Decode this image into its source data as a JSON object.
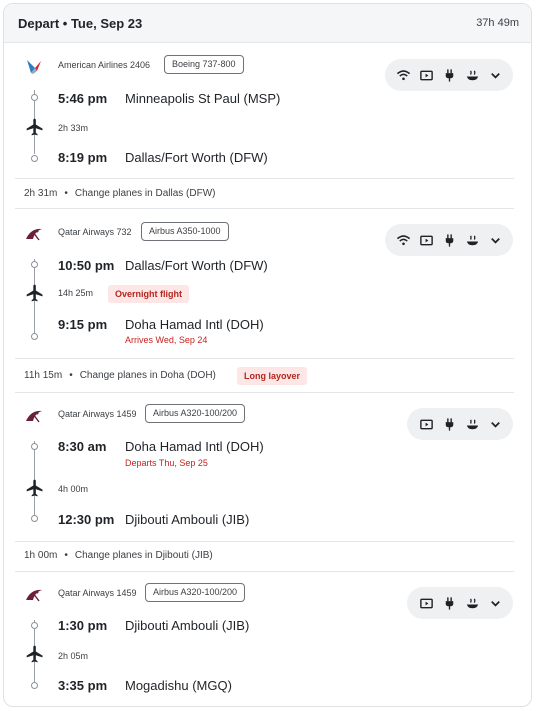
{
  "header": {
    "title": "Depart • Tue, Sep 23",
    "total_duration": "37h 49m"
  },
  "segments": [
    {
      "airline": "American Airlines",
      "flight": "American Airlines 2406",
      "aircraft": "Boeing 737-800",
      "depart_time": "5:46 pm",
      "depart_airport": "Minneapolis St Paul (MSP)",
      "duration": "2h 33m",
      "arrive_time": "8:19 pm",
      "arrive_airport": "Dallas/Fort Worth (DFW)",
      "amenities": [
        "wifi-icon",
        "screen-icon",
        "power-plug-icon",
        "meal-icon",
        "chevron-down-icon"
      ]
    },
    {
      "airline": "Qatar Airways",
      "flight": "Qatar Airways 732",
      "aircraft": "Airbus A350-1000",
      "depart_time": "10:50 pm",
      "depart_airport": "Dallas/Fort Worth (DFW)",
      "duration": "14h 25m",
      "badge": "Overnight flight",
      "arrive_time": "9:15 pm",
      "arrive_airport": "Doha Hamad Intl (DOH)",
      "arrive_note": "Arrives Wed, Sep 24",
      "amenities": [
        "wifi-icon",
        "screen-icon",
        "power-plug-icon",
        "meal-icon",
        "chevron-down-icon"
      ]
    },
    {
      "airline": "Qatar Airways",
      "flight": "Qatar Airways 1459",
      "aircraft": "Airbus A320-100/200",
      "depart_time": "8:30 am",
      "depart_airport": "Doha Hamad Intl (DOH)",
      "depart_note": "Departs Thu, Sep 25",
      "duration": "4h 00m",
      "arrive_time": "12:30 pm",
      "arrive_airport": "Djibouti Ambouli (JIB)",
      "amenities": [
        "screen-icon",
        "power-plug-icon",
        "meal-icon",
        "chevron-down-icon"
      ]
    },
    {
      "airline": "Qatar Airways",
      "flight": "Qatar Airways 1459",
      "aircraft": "Airbus A320-100/200",
      "depart_time": "1:30 pm",
      "depart_airport": "Djibouti Ambouli (JIB)",
      "duration": "2h 05m",
      "arrive_time": "3:35 pm",
      "arrive_airport": "Mogadishu (MGQ)",
      "amenities": [
        "screen-icon",
        "power-plug-icon",
        "meal-icon",
        "chevron-down-icon"
      ]
    }
  ],
  "layovers": [
    {
      "duration": "2h 31m",
      "text": "Change planes in Dallas (DFW)"
    },
    {
      "duration": "11h 15m",
      "text": "Change planes in Doha (DOH)",
      "badge": "Long layover"
    },
    {
      "duration": "1h 00m",
      "text": "Change planes in Djibouti (JIB)"
    }
  ],
  "colors": {
    "warning_bg": "#fde7e6",
    "warning_text": "#b3261e",
    "date_change": "#c5221f",
    "amenity_bg": "#eef0f2"
  }
}
